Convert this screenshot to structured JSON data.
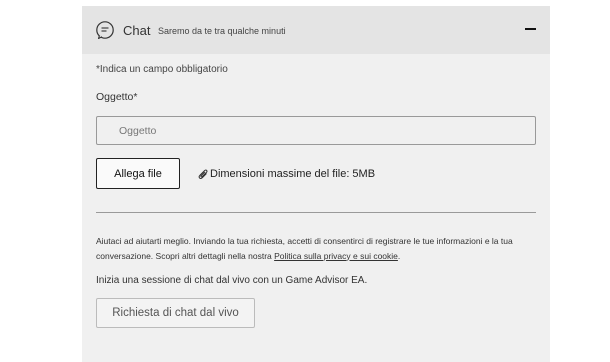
{
  "chat_panel": {
    "icon": "chat-bubble-icon",
    "title": "Chat",
    "subtitle": "Saremo da te tra qualche minuti",
    "collapse_icon": "minus-icon"
  },
  "form": {
    "required_note": "*Indica un campo obbligatorio",
    "subject_label": "Oggetto*",
    "subject_placeholder": "Oggetto",
    "subject_value": "",
    "attach_button": "Allega file",
    "attach_icon": "paperclip-icon",
    "max_size_text": "Dimensioni massime del file: 5MB"
  },
  "privacy": {
    "text_before": "Aiutaci ad aiutarti meglio. Inviando la tua richiesta, accetti di consentirci di registrare le tue informazioni e la tua conversazione. Scopri altri dettagli nella nostra ",
    "link_text": "Politica sulla privacy e sui cookie",
    "text_after": "."
  },
  "session": {
    "text": "Inizia una sessione di chat dal vivo con un Game Advisor EA.",
    "button": "Richiesta di chat dal vivo"
  }
}
